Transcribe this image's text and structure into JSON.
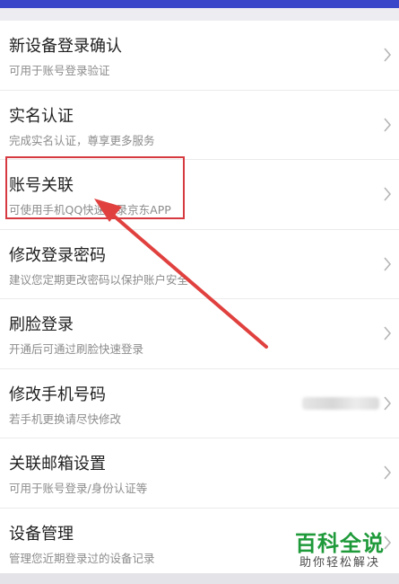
{
  "settings_list": {
    "items": [
      {
        "title": "新设备登录确认",
        "subtitle": "可用于账号登录验证"
      },
      {
        "title": "实名认证",
        "subtitle": "完成实名认证，尊享更多服务"
      },
      {
        "title": "账号关联",
        "subtitle": "可使用手机QQ快速登录京东APP"
      },
      {
        "title": "修改登录密码",
        "subtitle": "建议您定期更改密码以保护账户安全"
      },
      {
        "title": "刷脸登录",
        "subtitle": "开通后可通过刷脸快速登录"
      },
      {
        "title": "修改手机号码",
        "subtitle": "若手机更换请尽快修改"
      },
      {
        "title": "关联邮箱设置",
        "subtitle": "可用于账号登录/身份认证等"
      },
      {
        "title": "设备管理",
        "subtitle": "管理您近期登录过的设备记录"
      }
    ]
  },
  "annotation": {
    "highlight_color": "#d63a40",
    "arrow_color": "#e0413f"
  },
  "watermark": {
    "main": "百科全说",
    "sub": "助你轻松解决"
  },
  "colors": {
    "header": "#3a46c9",
    "watermark_green": "#1f9a3a"
  },
  "icons": {
    "row_chevron": "chevron-right-icon"
  }
}
